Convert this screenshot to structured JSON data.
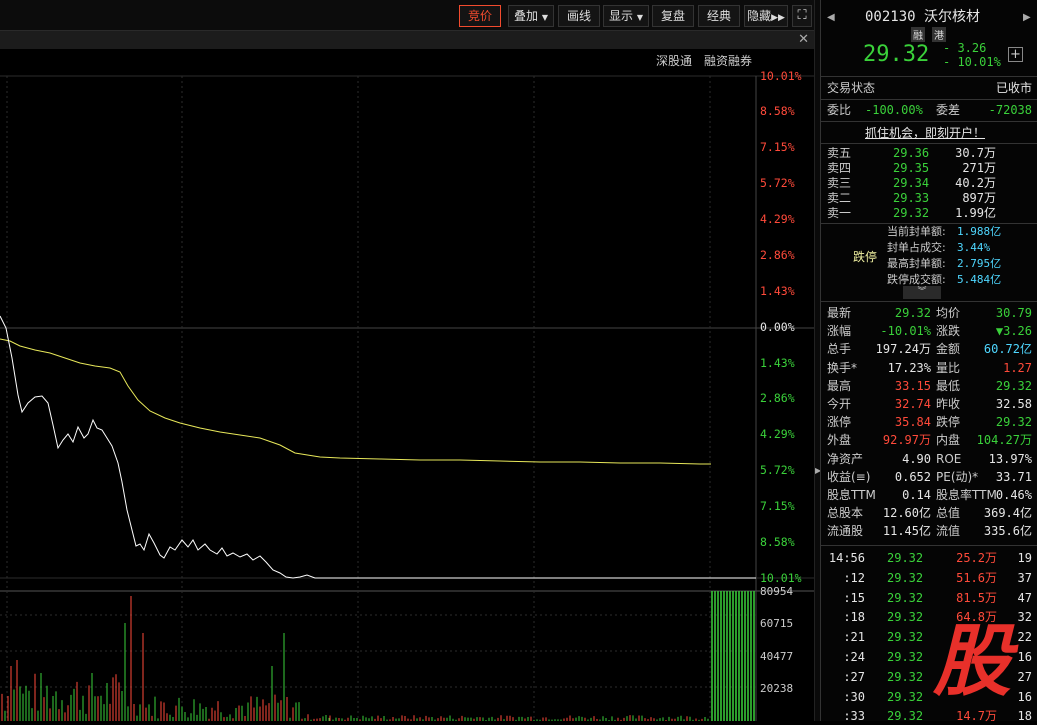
{
  "toolbar": {
    "buttons": [
      "竞价",
      "叠加",
      "画线",
      "显示",
      "复盘",
      "经典",
      "隐藏"
    ],
    "active_index": 0
  },
  "chart": {
    "tags": [
      "深股通",
      "融资融券"
    ],
    "price_pct_labels": [
      "10.01%",
      "8.58%",
      "7.15%",
      "5.72%",
      "4.29%",
      "2.86%",
      "1.43%",
      "0.00%",
      "1.43%",
      "2.86%",
      "4.29%",
      "5.72%",
      "7.15%",
      "8.58%",
      "10.01%"
    ],
    "volume_labels": [
      "80954",
      "60715",
      "40477",
      "20238"
    ],
    "colors": {
      "up": "#ff4a3a",
      "down": "#3ad13a",
      "avg": "#e8e85a",
      "price": "#ffffff"
    }
  },
  "stock": {
    "code": "002130",
    "name": "沃尔核材",
    "badges": [
      "融",
      "港"
    ],
    "price": "29.32",
    "change": "- 3.26",
    "change_pct": "- 10.01%",
    "status_label": "交易状态",
    "status_value": "已收市",
    "weibi_label": "委比",
    "weibi": "-100.00%",
    "weicha_label": "委差",
    "weicha": "-72038",
    "promo": "抓住机会，即刻开户！"
  },
  "asks": [
    {
      "label": "卖五",
      "price": "29.36",
      "vol": "30.7万"
    },
    {
      "label": "卖四",
      "price": "29.35",
      "vol": "271万"
    },
    {
      "label": "卖三",
      "price": "29.34",
      "vol": "40.2万"
    },
    {
      "label": "卖二",
      "price": "29.33",
      "vol": "897万"
    },
    {
      "label": "卖一",
      "price": "29.32",
      "vol": "1.99亿"
    }
  ],
  "limit_info": {
    "title": "跌停",
    "items": [
      {
        "label": "当前封单额:",
        "value": "1.988亿"
      },
      {
        "label": "封单占成交:",
        "value": "3.44%"
      },
      {
        "label": "最高封单额:",
        "value": "2.795亿"
      },
      {
        "label": "跌停成交额:",
        "value": "5.484亿"
      }
    ]
  },
  "quote": [
    {
      "l1": "最新",
      "v1": "29.32",
      "c1": "green",
      "l2": "均价",
      "v2": "30.79",
      "c2": "green"
    },
    {
      "l1": "涨幅",
      "v1": "-10.01%",
      "c1": "green",
      "l2": "涨跌",
      "v2": "▼3.26",
      "c2": "green"
    },
    {
      "l1": "总手",
      "v1": "197.24万",
      "c1": "white",
      "l2": "金额",
      "v2": "60.72亿",
      "c2": "cyan"
    },
    {
      "l1": "换手*",
      "v1": "17.23%",
      "c1": "white",
      "l2": "量比",
      "v2": "1.27",
      "c2": "red"
    },
    {
      "l1": "最高",
      "v1": "33.15",
      "c1": "red",
      "l2": "最低",
      "v2": "29.32",
      "c2": "green"
    },
    {
      "l1": "今开",
      "v1": "32.74",
      "c1": "red",
      "l2": "昨收",
      "v2": "32.58",
      "c2": "white"
    },
    {
      "l1": "涨停",
      "v1": "35.84",
      "c1": "red",
      "l2": "跌停",
      "v2": "29.32",
      "c2": "green"
    },
    {
      "l1": "外盘",
      "v1": "92.97万",
      "c1": "red",
      "l2": "内盘",
      "v2": "104.27万",
      "c2": "green"
    },
    {
      "l1": "净资产",
      "v1": "4.90",
      "c1": "white",
      "l2": "ROE",
      "v2": "13.97%",
      "c2": "white"
    },
    {
      "l1": "收益(≡)",
      "v1": "0.652",
      "c1": "white",
      "l2": "PE(动)*",
      "v2": "33.71",
      "c2": "white"
    },
    {
      "l1": "股息TTM",
      "v1": "0.14",
      "c1": "white",
      "l2": "股息率TTM",
      "v2": "0.46%",
      "c2": "white"
    },
    {
      "l1": "总股本",
      "v1": "12.60亿",
      "c1": "white",
      "l2": "总值",
      "v2": "369.4亿",
      "c2": "white"
    },
    {
      "l1": "流通股",
      "v1": "11.45亿",
      "c1": "white",
      "l2": "流值",
      "v2": "335.6亿",
      "c2": "white"
    }
  ],
  "ticks": [
    {
      "time": "14:56",
      "price": "29.32",
      "vol": "25.2万",
      "n": "19"
    },
    {
      "time": ":12",
      "price": "29.32",
      "vol": "51.6万",
      "n": "37"
    },
    {
      "time": ":15",
      "price": "29.32",
      "vol": "81.5万",
      "n": "47"
    },
    {
      "time": ":18",
      "price": "29.32",
      "vol": "64.8万",
      "n": "32"
    },
    {
      "time": ":21",
      "price": "29.32",
      "vol": "",
      "n": "22"
    },
    {
      "time": ":24",
      "price": "29.32",
      "vol": "",
      "n": "16"
    },
    {
      "time": ":27",
      "price": "29.32",
      "vol": "",
      "n": "27"
    },
    {
      "time": ":30",
      "price": "29.32",
      "vol": "",
      "n": "16"
    },
    {
      "time": ":33",
      "price": "29.32",
      "vol": "14.7万",
      "n": "18"
    }
  ],
  "watermark": "股"
}
